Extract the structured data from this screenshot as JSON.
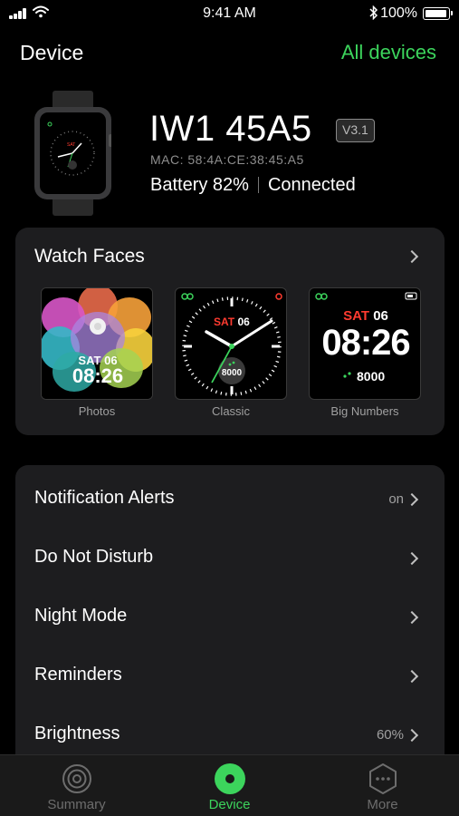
{
  "status_bar": {
    "time": "9:41 AM",
    "battery": "100%"
  },
  "header": {
    "title": "Device",
    "all_devices": "All devices"
  },
  "device": {
    "name": "IW1 45A5",
    "version": "V3.1",
    "mac": "MAC: 58:4A:CE:38:45:A5",
    "battery": "Battery 82%",
    "status": "Connected"
  },
  "watch_faces": {
    "title": "Watch Faces",
    "faces": [
      {
        "label": "Photos",
        "day": "SAT",
        "date": "06",
        "time": "08:26"
      },
      {
        "label": "Classic",
        "day": "SAT",
        "date": "06",
        "steps": "8000"
      },
      {
        "label": "Big Numbers",
        "day": "SAT",
        "date": "06",
        "time": "08:26",
        "steps": "8000"
      }
    ]
  },
  "settings": [
    {
      "label": "Notification Alerts",
      "value": "on"
    },
    {
      "label": "Do Not Disturb",
      "value": ""
    },
    {
      "label": "Night Mode",
      "value": ""
    },
    {
      "label": "Reminders",
      "value": ""
    },
    {
      "label": "Brightness",
      "value": "60%"
    }
  ],
  "tabs": [
    {
      "label": "Summary",
      "icon": "summary-icon"
    },
    {
      "label": "Device",
      "icon": "device-icon",
      "active": true
    },
    {
      "label": "More",
      "icon": "more-icon"
    }
  ],
  "colors": {
    "accent": "#3cd45c",
    "card": "#1d1d1f",
    "background": "#000000",
    "date_red": "#ff3b30"
  }
}
